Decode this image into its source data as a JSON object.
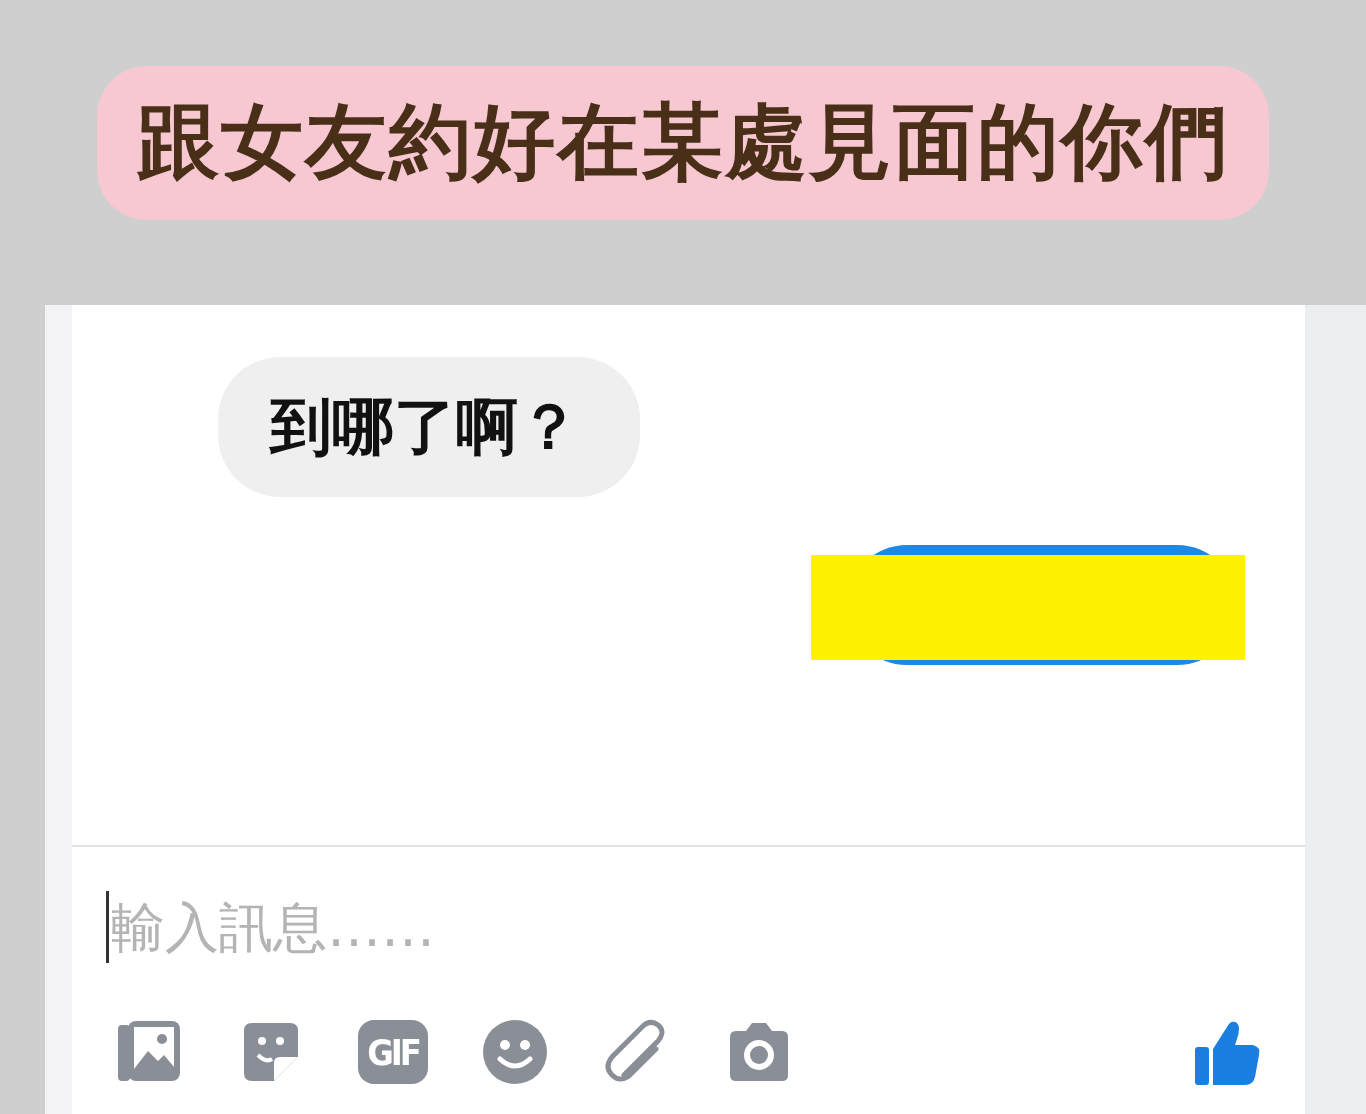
{
  "caption": "跟女友約好在某處見面的你們",
  "messages": [
    {
      "kind": "received",
      "text": "到哪了啊？"
    },
    {
      "kind": "sent"
    }
  ],
  "composer": {
    "placeholder": "輸入訊息……",
    "gif_label": "GIF"
  }
}
